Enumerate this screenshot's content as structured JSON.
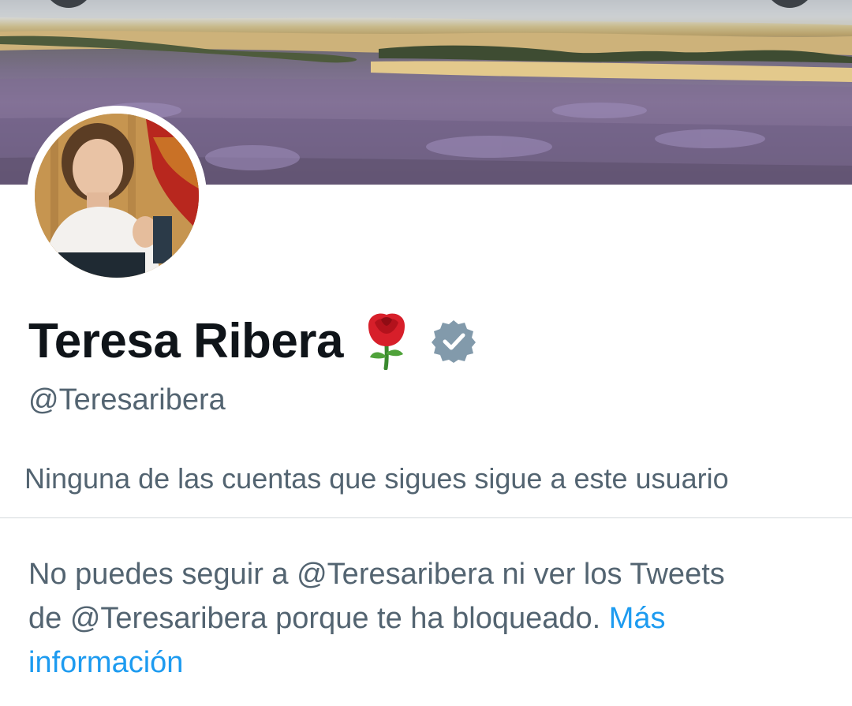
{
  "profile": {
    "display_name": "Teresa Ribera",
    "name_emoji_icon": "rose-icon",
    "verified_icon": "verified-badge-icon",
    "handle": "@Teresaribera",
    "followers_you_know": "Ninguna de las cuentas que sigues sigue a este usuario"
  },
  "blocked_notice": {
    "line1": "No puedes seguir a @Teresaribera ni ver los Tweets",
    "line2": "de @Teresaribera porque te ha bloqueado.",
    "link_label": "Más información"
  },
  "colors": {
    "text_primary": "#0f1419",
    "text_secondary": "#536471",
    "link": "#1d9bf0",
    "verified_badge": "#829aab"
  }
}
